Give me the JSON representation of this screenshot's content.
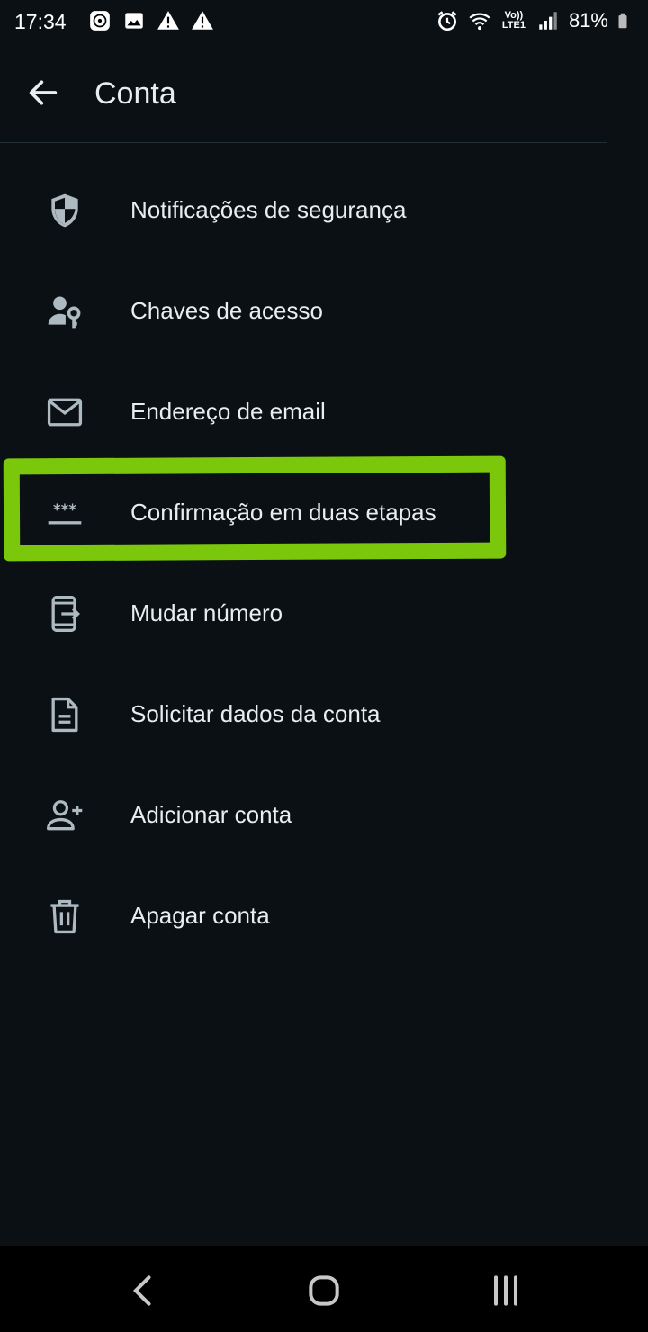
{
  "status_bar": {
    "time": "17:34",
    "network_top": "Vo))",
    "network_bottom": "LTE1",
    "battery": "81%",
    "left_icons": [
      "music-icon",
      "image-icon",
      "warning-icon",
      "warning-icon"
    ],
    "right_icons": [
      "alarm-icon",
      "wifi-icon",
      "signal-icon",
      "battery-icon"
    ]
  },
  "header": {
    "title": "Conta",
    "back_icon": "arrow-left-icon"
  },
  "menu": {
    "items": [
      {
        "label": "Notificações de segurança",
        "icon": "shield-icon"
      },
      {
        "label": "Chaves de acesso",
        "icon": "person-key-icon"
      },
      {
        "label": "Endereço de email",
        "icon": "envelope-icon"
      },
      {
        "label": "Confirmação em duas etapas",
        "icon": "password-dots-icon"
      },
      {
        "label": "Mudar número",
        "icon": "phone-change-icon"
      },
      {
        "label": "Solicitar dados da conta",
        "icon": "document-icon"
      },
      {
        "label": "Adicionar conta",
        "icon": "person-add-icon"
      },
      {
        "label": "Apagar conta",
        "icon": "trash-icon"
      }
    ]
  },
  "annotation": {
    "color": "#7ac70c"
  },
  "nav_bar": {
    "icons": [
      "back-chevron-icon",
      "home-icon",
      "recents-icon"
    ]
  },
  "colors": {
    "background": "#0b1014",
    "text": "#e9edef",
    "icon": "#aebac1"
  }
}
